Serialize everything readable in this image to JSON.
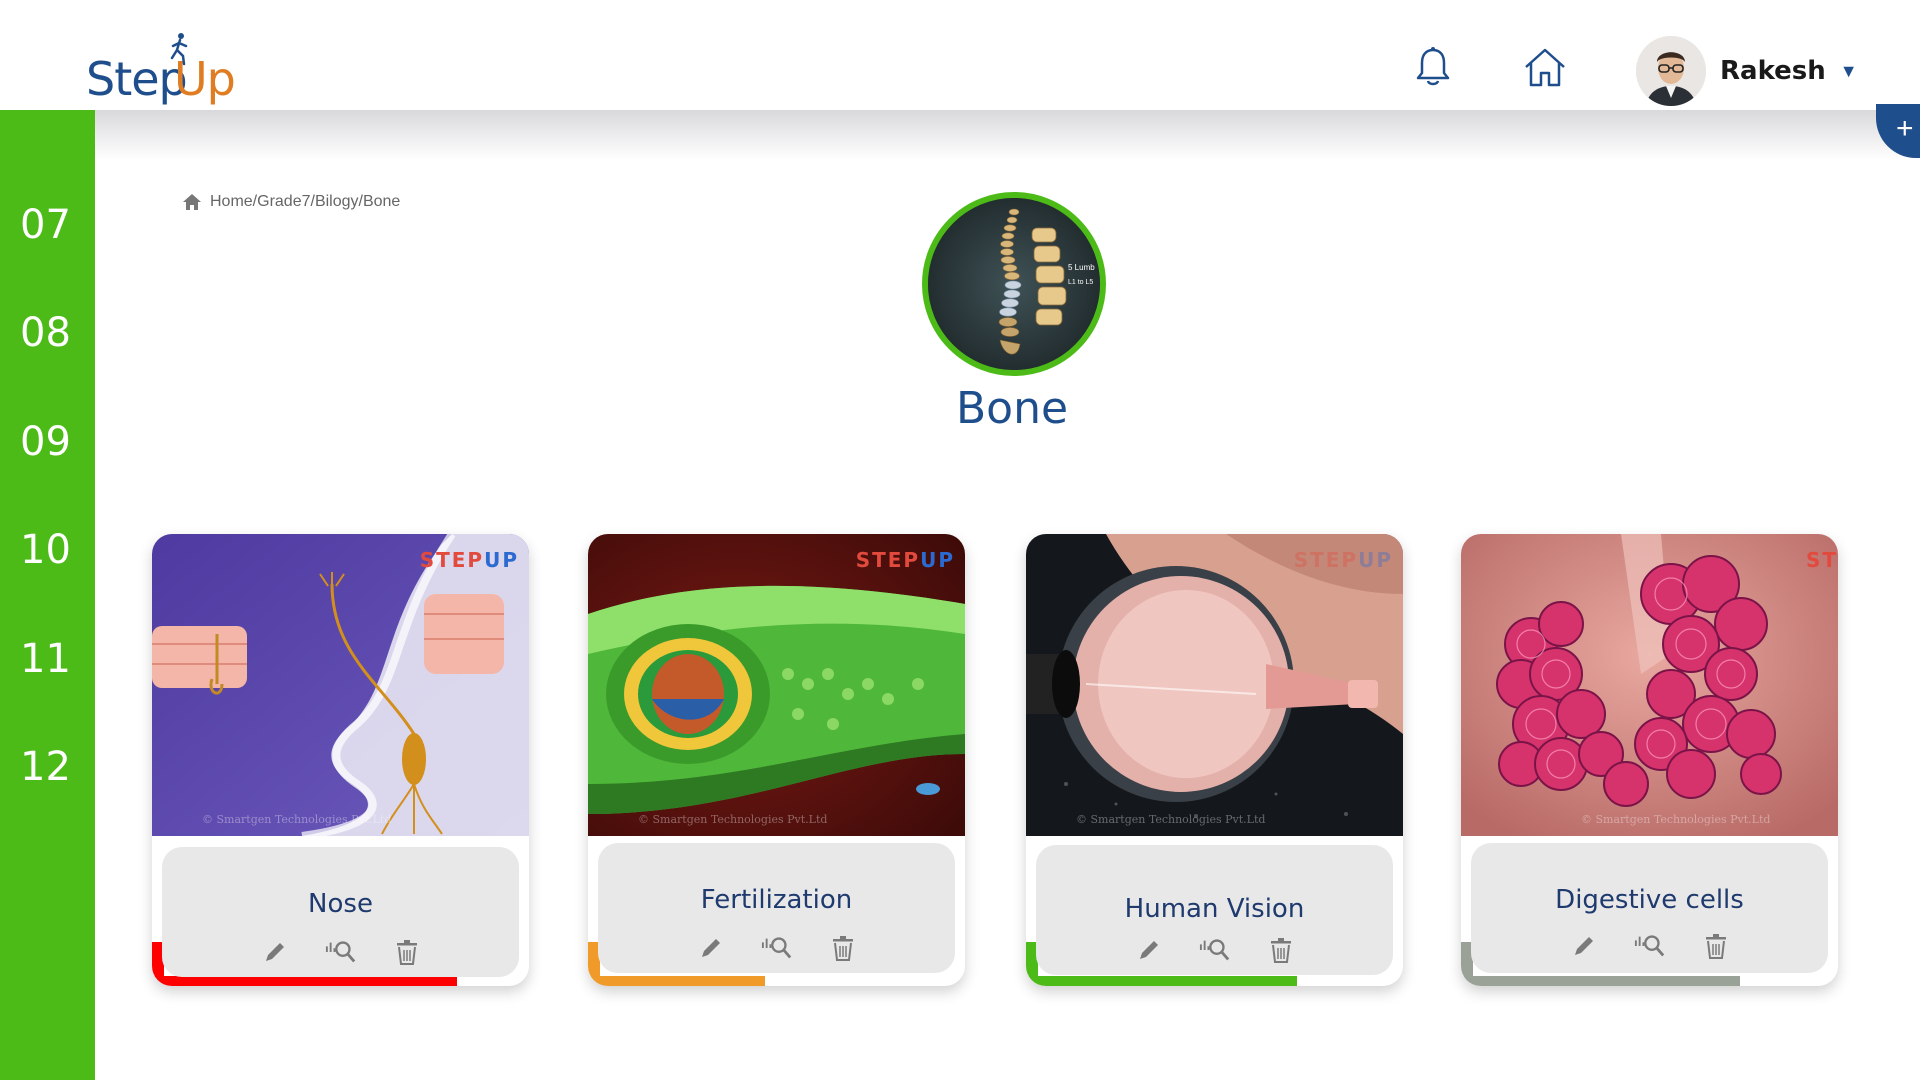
{
  "app": {
    "logo_step": "Step",
    "logo_up": "Up",
    "user_name": "Rakesh",
    "accent": "#4cbb17",
    "brand_blue": "#1f4e8c"
  },
  "sidebar": {
    "grades": [
      "07",
      "08",
      "09",
      "10",
      "11",
      "12"
    ]
  },
  "breadcrumb": "Home/Grade7/Bilogy/Bone",
  "topic": {
    "title": "Bone",
    "image_labels": [
      "5 Lumb",
      "L1 to L5"
    ]
  },
  "cards": [
    {
      "title": "Nose",
      "progress": 0.81,
      "color": "#ff0000",
      "brand": "STEP",
      "brand2": "UP"
    },
    {
      "title": "Fertilization",
      "progress": 0.47,
      "color": "#f09a2a",
      "brand": "STEP",
      "brand2": "UP"
    },
    {
      "title": "Human Vision",
      "progress": 0.72,
      "color": "#4cbb17",
      "brand": "STEP",
      "brand2": "UP"
    },
    {
      "title": "Digestive cells",
      "progress": 0.74,
      "color": "#9aa197",
      "brand": "ST",
      "brand2": ""
    }
  ],
  "watermark": "© Smartgen Technologies Pvt.Ltd",
  "icons": {
    "edit": "pencil-icon",
    "analyze": "search-analytics-icon",
    "delete": "trash-icon"
  }
}
